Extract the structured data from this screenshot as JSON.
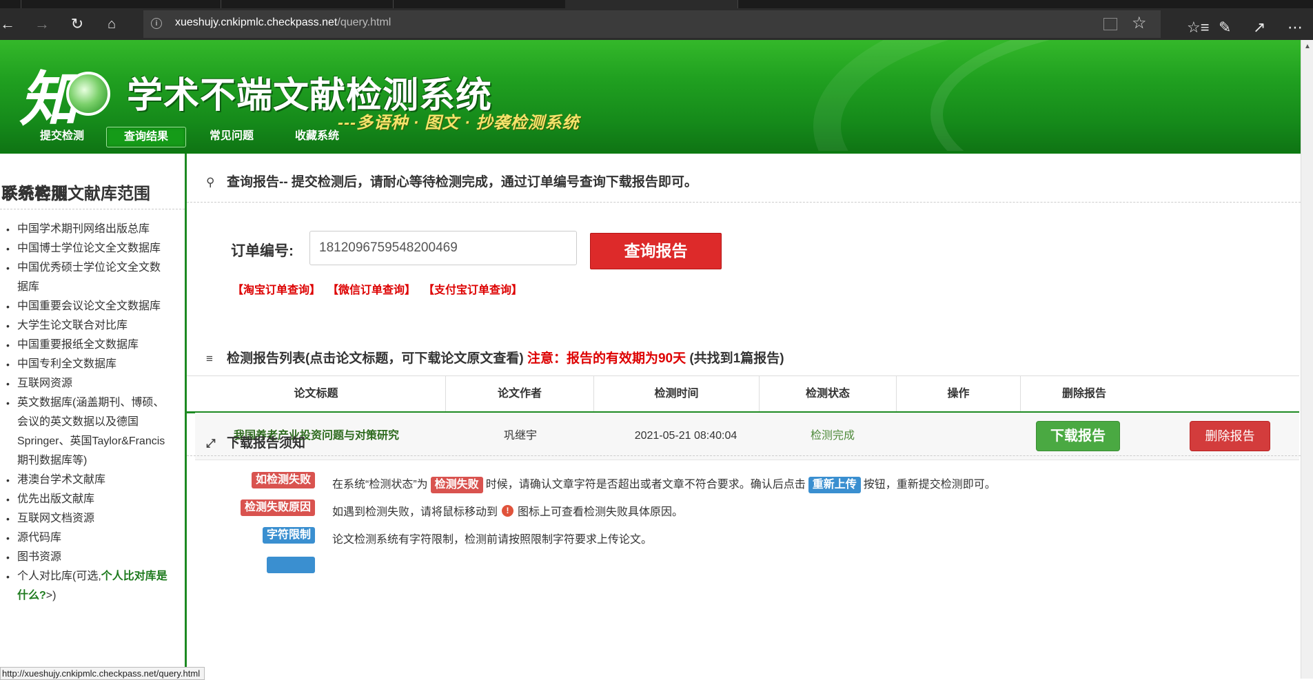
{
  "browser": {
    "url_host": "xueshujy.cnkipmlc.checkpass.net",
    "url_path": "/query.html",
    "status_url": "http://xueshujy.cnkipmlc.checkpass.net/query.html"
  },
  "site": {
    "title": "学术不端文献检测系统",
    "subtitle": "---多语种 · 图文 · 抄袭检测系统",
    "nav": [
      "提交检测",
      "查询结果",
      "常见问题",
      "收藏系统"
    ],
    "active_nav": "查询结果"
  },
  "sidebar": {
    "heading": "系统检测文献库范围",
    "items": [
      "中国学术期刊网络出版总库",
      "中国博士学位论文全文数据库",
      "中国优秀硕士学位论文全文数",
      "据库",
      "中国重要会议论文全文数据库",
      "大学生论文联合对比库",
      "中国重要报纸全文数据库",
      "中国专利全文数据库",
      "互联网资源",
      "英文数据库(涵盖期刊、博硕、",
      "会议的英文数据以及德国",
      "Springer、英国Taylor&Francis",
      "期刊数据库等)",
      "港澳台学术文献库",
      "优先出版文献库",
      "互联网文档资源",
      "源代码库",
      "图书资源"
    ],
    "personal_prefix": "个人对比库(可选,",
    "personal_link": "个人比对库是",
    "personal_link_2": "什么?",
    "personal_suffix": ">)",
    "contact_heading": "联系客服"
  },
  "query": {
    "heading": "查询报告-- 提交检测后，请耐心等待检测完成，通过订单编号查询下载报告即可。",
    "order_label": "订单编号:",
    "order_value": "1812096759548200469",
    "query_button": "查询报告",
    "links": [
      "【淘宝订单查询】",
      "【微信订单查询】",
      "【支付宝订单查询】"
    ]
  },
  "report_list": {
    "heading": "检测报告列表(点击论文标题，可下载论文原文查看)",
    "warning": "注意：报告的有效期为90天",
    "count_text": "(共找到1篇报告)",
    "columns": [
      "论文标题",
      "论文作者",
      "检测时间",
      "检测状态",
      "操作",
      "删除报告"
    ],
    "rows": [
      {
        "title": "我国养老产业投资问题与对策研究",
        "author": "巩继宇",
        "time": "2021-05-21 08:40:04",
        "status": "检测完成",
        "download": "下载报告",
        "delete": "删除报告"
      }
    ]
  },
  "notice": {
    "heading": "下载报告须知",
    "rows": [
      {
        "label": "如检测失败",
        "text_1": "在系统“检测状态”为",
        "badge_1": "检测失败",
        "text_2": "时候，请确认文章字符是否超出或者文章不符合要求。确认后点击",
        "badge_2": "重新上传",
        "text_3": "按钮，重新提交检测即可。"
      },
      {
        "label": "检测失败原因",
        "text_1": "如遇到检测失败，请将鼠标移动到",
        "text_2": "图标上可查看检测失败具体原因。"
      },
      {
        "label": "字符限制",
        "text_1": "论文检测系统有字符限制，检测前请按照限制字符要求上传论文。"
      }
    ]
  },
  "colors": {
    "header_green": "#1a9a1e",
    "accent_red": "#dd2a2a",
    "download_green": "#4aa942",
    "badge_blue": "#3a8fd0"
  }
}
